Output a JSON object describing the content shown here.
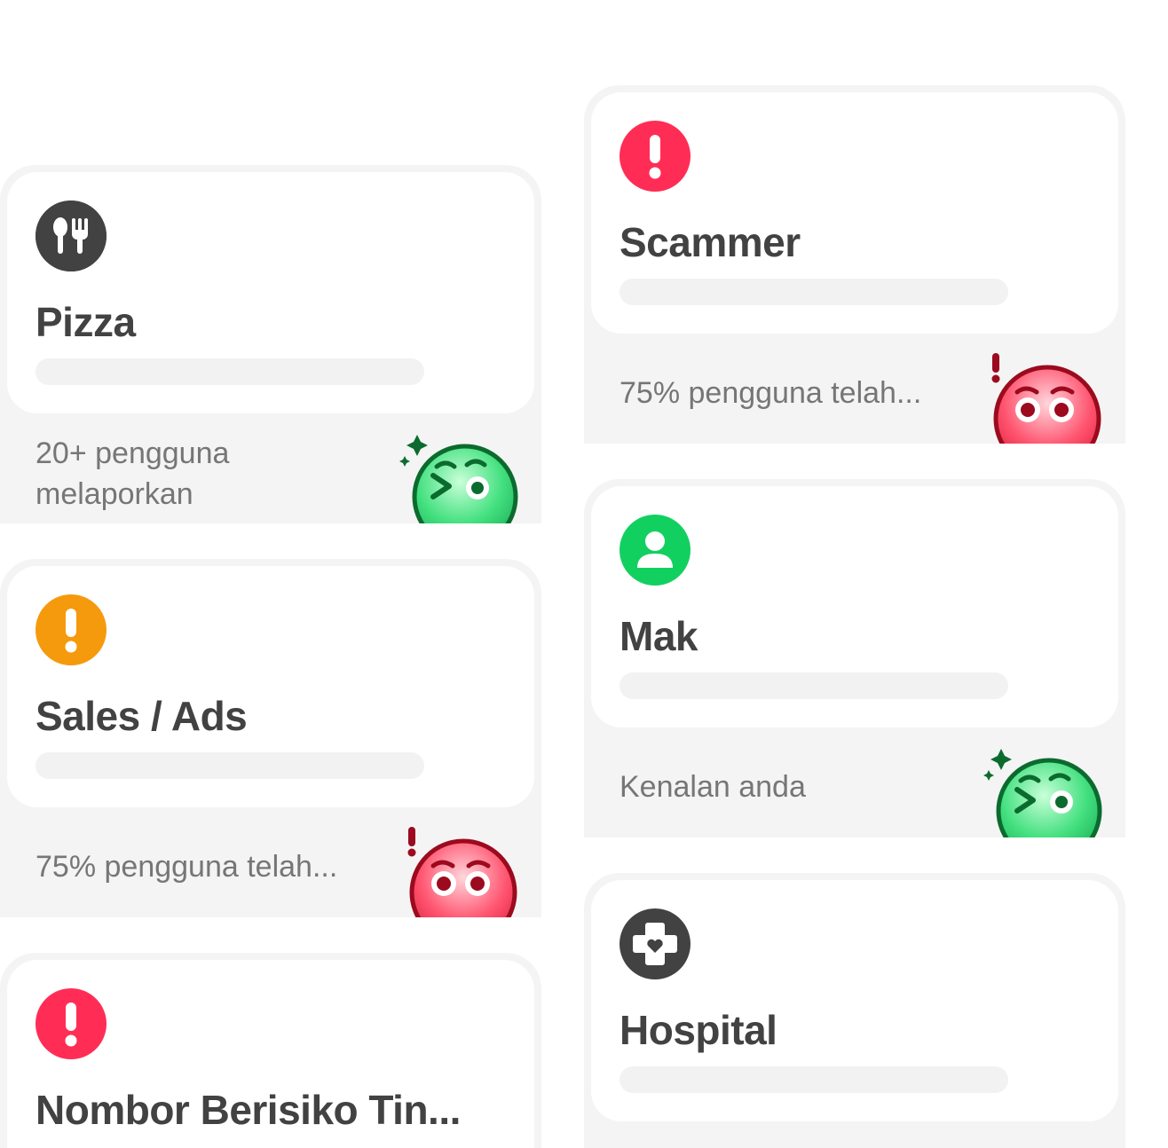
{
  "cards": [
    {
      "title": "Pizza",
      "footer": "20+ pengguna melaporkan",
      "icon": "utensils-icon",
      "icon_color": "#424242",
      "face": "winking-green-face"
    },
    {
      "title": "Sales / Ads",
      "footer": "75% pengguna telah...",
      "icon": "exclamation-icon",
      "icon_color": "#f59a0c",
      "face": "angry-red-face"
    },
    {
      "title": "Nombor Berisiko Tin...",
      "icon": "exclamation-icon",
      "icon_color": "#ff2d55"
    },
    {
      "title": "Scammer",
      "footer": "75% pengguna telah...",
      "icon": "exclamation-icon",
      "icon_color": "#ff2d55",
      "face": "angry-red-face"
    },
    {
      "title": "Mak",
      "footer": "Kenalan anda",
      "icon": "person-icon",
      "icon_color": "#12d05f",
      "face": "winking-green-face"
    },
    {
      "title": "Hospital",
      "icon": "medical-cross-icon",
      "icon_color": "#424242"
    }
  ]
}
